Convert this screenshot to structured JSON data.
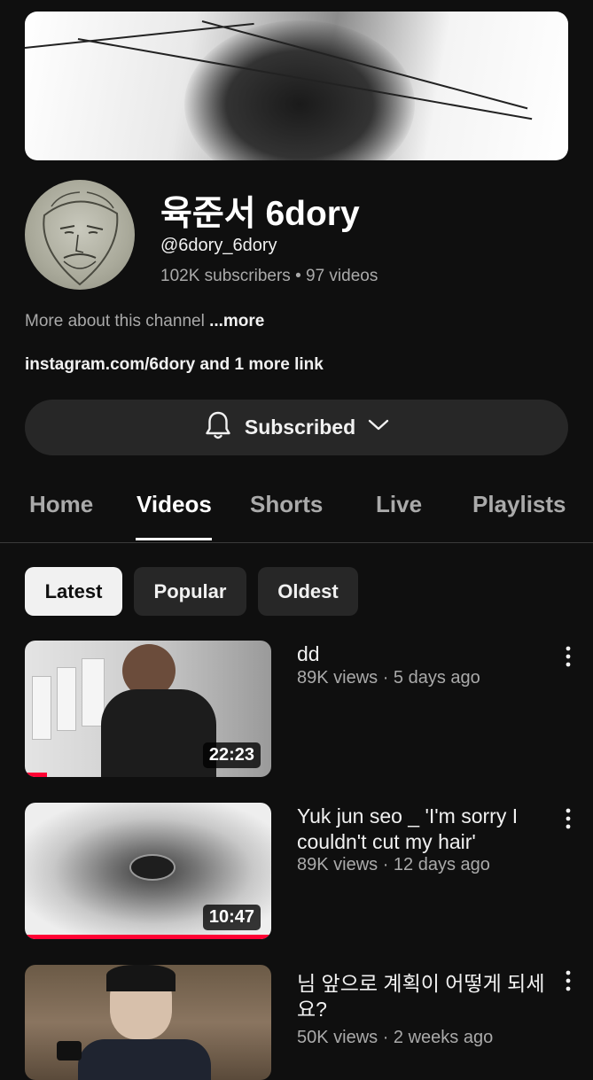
{
  "channel": {
    "name": "육준서 6dory",
    "handle": "@6dory_6dory",
    "stats": "102K subscribers • 97 videos",
    "about": "More about this channel ",
    "about_more": "...more",
    "link": "instagram.com/6dory and 1 more link",
    "subscribe_label": "Subscribed"
  },
  "tabs": [
    {
      "label": "Home",
      "active": false
    },
    {
      "label": "Videos",
      "active": true
    },
    {
      "label": "Shorts",
      "active": false
    },
    {
      "label": "Live",
      "active": false
    },
    {
      "label": "Playlists",
      "active": false
    }
  ],
  "chips": [
    {
      "label": "Latest",
      "active": true
    },
    {
      "label": "Popular",
      "active": false
    },
    {
      "label": "Oldest",
      "active": false
    }
  ],
  "videos": [
    {
      "title": "dd",
      "meta": "89K views · 5 days ago",
      "duration": "22:23",
      "progress": 0.09
    },
    {
      "title": "Yuk jun seo _ 'I'm sorry I couldn't cut my hair'",
      "meta": "89K views · 12 days ago",
      "duration": "10:47",
      "progress": 1.0
    },
    {
      "title": "님 앞으로 계획이 어떻게 되세요?",
      "meta": "50K views · 2 weeks ago"
    }
  ],
  "icons": {
    "bell": "bell-icon",
    "chevron": "chevron-down-icon",
    "kebab": "more-vert-icon"
  },
  "colors": {
    "background": "#0f0f0f",
    "progress": "#ff0033"
  }
}
